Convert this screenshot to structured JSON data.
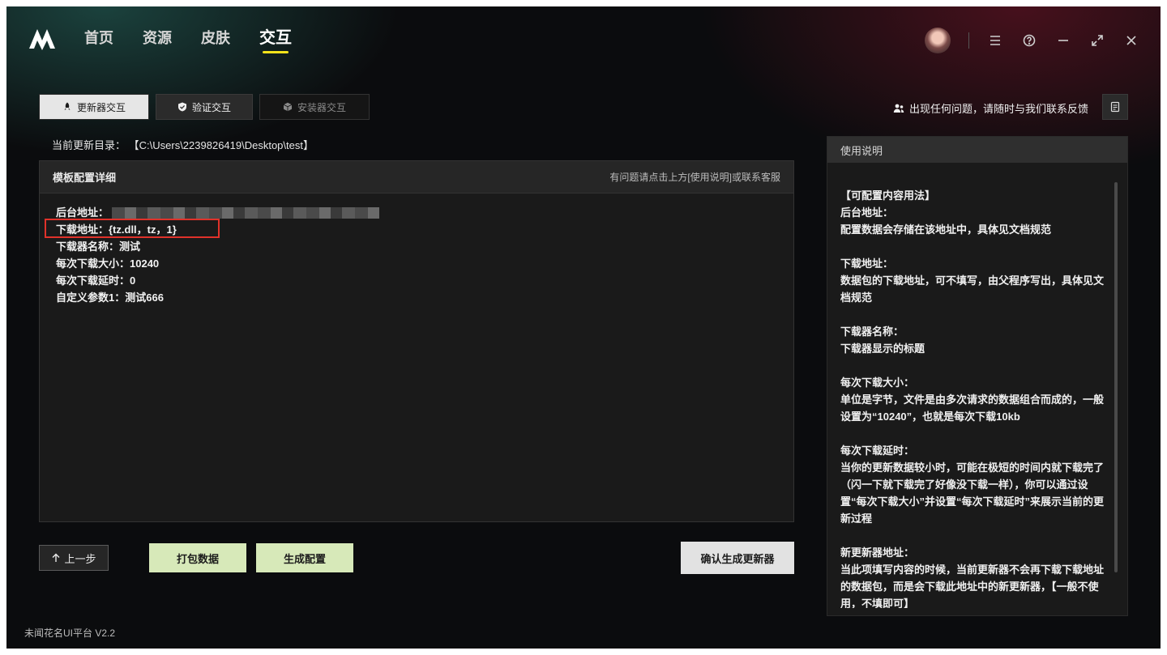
{
  "nav": {
    "items": [
      {
        "label": "首页"
      },
      {
        "label": "资源"
      },
      {
        "label": "皮肤"
      },
      {
        "label": "交互"
      }
    ],
    "active_index": 3
  },
  "tabs": [
    {
      "label": "更新器交互",
      "icon": "rocket-icon"
    },
    {
      "label": "验证交互",
      "icon": "shield-check-icon"
    },
    {
      "label": "安装器交互",
      "icon": "box-icon"
    }
  ],
  "feedback": {
    "label": "出现任何问题，请随时与我们联系反馈"
  },
  "path": {
    "label": "当前更新目录：",
    "value": "【C:\\Users\\2239826419\\Desktop\\test】"
  },
  "config_panel": {
    "title": "模板配置详细",
    "hint": "有问题请点击上方[使用说明]或联系客服",
    "rows": [
      {
        "text": "后台地址："
      },
      {
        "text": "下载地址：{tz.dll，tz，1}"
      },
      {
        "text": "下载器名称：测试"
      },
      {
        "text": "每次下载大小：10240"
      },
      {
        "text": "每次下载延时：0"
      },
      {
        "text": "自定义参数1：测试666"
      }
    ]
  },
  "buttons": {
    "prev": "上一步",
    "pack": "打包数据",
    "generate": "生成配置",
    "confirm": "确认生成更新器"
  },
  "help": {
    "title": "使用说明",
    "lines": [
      "【可配置内容用法】",
      "后台地址：",
      "配置数据会存储在该地址中，具体见文档规范",
      "",
      "下载地址：",
      "数据包的下载地址，可不填写，由父程序写出，具体见文档规范",
      "",
      "下载器名称：",
      "下载器显示的标题",
      "",
      "每次下载大小：",
      "单位是字节，文件是由多次请求的数据组合而成的，一般设置为“10240”，也就是每次下载10kb",
      "",
      "每次下载延时：",
      "当你的更新数据较小时，可能在极短的时间内就下载完了（闪一下就下载完了好像没下载一样），你可以通过设置“每次下载大小”并设置“每次下载延时”来展示当前的更新过程",
      "",
      "新更新器地址：",
      "当此项填写内容的时候，当前更新器不会再下载下载地址的数据包，而是会下载此地址中的新更新器，【一般不使用，不填即可】"
    ]
  },
  "footer": {
    "version": "未闻花名UI平台 V2.2"
  },
  "colors": {
    "accent_underline": "#f3e21b",
    "highlight_border": "#e0322a",
    "primary_button": "#d7e9b9"
  }
}
